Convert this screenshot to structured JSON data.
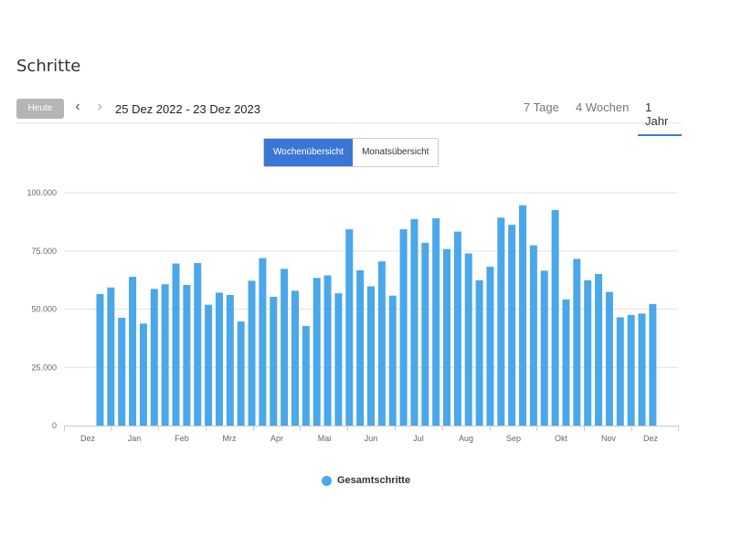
{
  "page": {
    "title": "Schritte"
  },
  "toolbar": {
    "today_label": "Heute",
    "prev_icon": "‹",
    "next_icon": "›",
    "date_range": "25 Dez 2022 - 23 Dez 2023",
    "range_tabs": [
      {
        "label": "7 Tage",
        "active": false
      },
      {
        "label": "4 Wochen",
        "active": false
      },
      {
        "label": "1 Jahr",
        "active": true
      }
    ]
  },
  "view_toggle": {
    "weekly_label": "Wochenübersicht",
    "monthly_label": "Monatsübersicht",
    "active": "weekly"
  },
  "colors": {
    "bar": "#4aa7ea",
    "accent": "#3a77d4",
    "grid": "#e3e3e3",
    "axis_text": "#666666"
  },
  "chart_data": {
    "type": "bar",
    "ylim": [
      0,
      100000
    ],
    "yticks": [
      0,
      25000,
      50000,
      75000,
      100000
    ],
    "ytick_labels": [
      "0",
      "25.000",
      "50.000",
      "75.000",
      "100.000"
    ],
    "month_labels": [
      "Dez",
      "Jan",
      "Feb",
      "Mrz",
      "Apr",
      "Mai",
      "Jun",
      "Jul",
      "Aug",
      "Sep",
      "Okt",
      "Nov",
      "Dez"
    ],
    "series": [
      {
        "name": "Gesamtschritte",
        "values": [
          56500,
          59300,
          46300,
          63900,
          43800,
          58700,
          60700,
          69600,
          60400,
          69800,
          51900,
          57100,
          56100,
          44700,
          62200,
          71900,
          55300,
          67300,
          57900,
          42800,
          63400,
          64500,
          56800,
          84300,
          66700,
          59800,
          70500,
          55800,
          84300,
          88700,
          78500,
          89000,
          75800,
          83300,
          73900,
          62400,
          68200,
          89300,
          86200,
          94600,
          77400,
          66500,
          92600,
          54200,
          71600,
          62400,
          65100,
          57400,
          46500,
          47500,
          48100,
          52200
        ]
      }
    ]
  },
  "legend": {
    "label": "Gesamtschritte"
  }
}
